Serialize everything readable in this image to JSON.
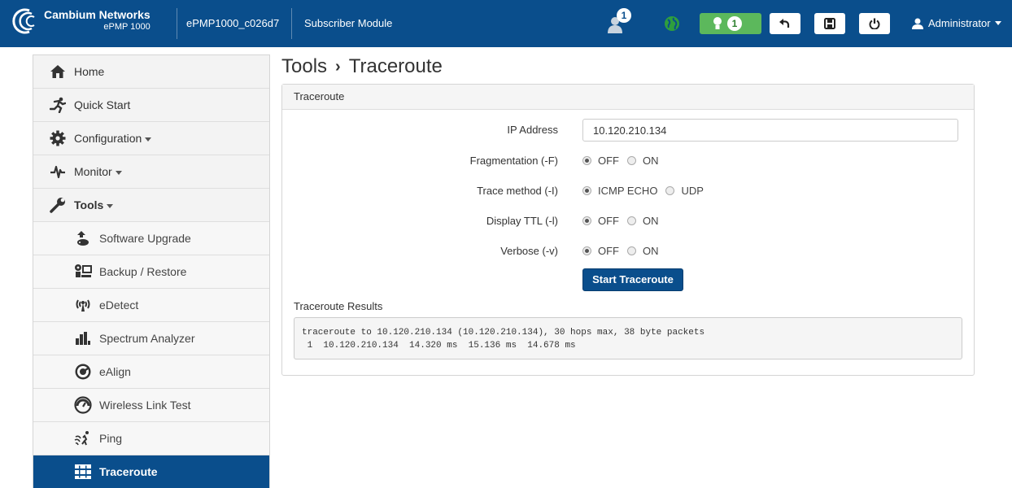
{
  "header": {
    "brand_name": "Cambium Networks",
    "brand_model": "ePMP 1000",
    "device_name": "ePMP1000_c026d7",
    "device_mode": "Subscriber Module",
    "user_alert_count": "1",
    "alarm_count": "1",
    "user_label": "Administrator",
    "colors": {
      "bar": "#0a4e8c",
      "alarm": "#5cb85c",
      "globe": "#2e9e3e"
    }
  },
  "sidebar": {
    "items": [
      {
        "label": "Home",
        "icon": "home-icon"
      },
      {
        "label": "Quick Start",
        "icon": "running-icon"
      },
      {
        "label": "Configuration",
        "icon": "gear-icon"
      },
      {
        "label": "Monitor",
        "icon": "pulse-icon"
      },
      {
        "label": "Tools",
        "icon": "wrench-icon"
      },
      {
        "label": "Software Upgrade",
        "icon": "upgrade-icon"
      },
      {
        "label": "Backup / Restore",
        "icon": "backup-icon"
      },
      {
        "label": "eDetect",
        "icon": "antenna-icon"
      },
      {
        "label": "Spectrum Analyzer",
        "icon": "bars-icon"
      },
      {
        "label": "eAlign",
        "icon": "dial-icon"
      },
      {
        "label": "Wireless Link Test",
        "icon": "speedometer-icon"
      },
      {
        "label": "Ping",
        "icon": "ping-icon"
      },
      {
        "label": "Traceroute",
        "icon": "traceroute-icon"
      }
    ]
  },
  "main": {
    "breadcrumb_parent": "Tools",
    "breadcrumb_sep": "›",
    "breadcrumb_current": "Traceroute",
    "panel_title": "Traceroute",
    "form": {
      "ip_label": "IP Address",
      "ip_value": "10.120.210.134",
      "frag_label": "Fragmentation (-F)",
      "trace_label": "Trace method (-I)",
      "ttl_label": "Display TTL (-l)",
      "verbose_label": "Verbose (-v)",
      "off_label": "OFF",
      "on_label": "ON",
      "icmp_label": "ICMP ECHO",
      "udp_label": "UDP",
      "fragmentation": "OFF",
      "trace_method": "ICMP ECHO",
      "display_ttl": "OFF",
      "verbose": "OFF"
    },
    "start_button": "Start Traceroute",
    "results_label": "Traceroute Results",
    "results_text": "traceroute to 10.120.210.134 (10.120.210.134), 30 hops max, 38 byte packets\n 1  10.120.210.134  14.320 ms  15.136 ms  14.678 ms"
  }
}
